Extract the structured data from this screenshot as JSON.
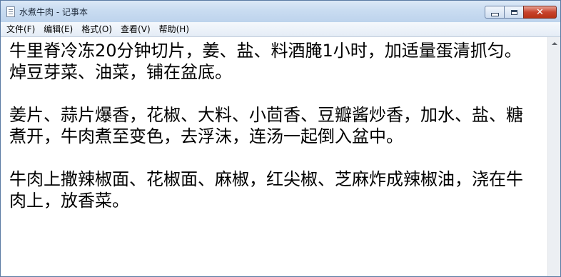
{
  "window": {
    "title": "水煮牛肉 - 记事本",
    "icon": "notepad-icon",
    "controls": {
      "minimize": "minimize-icon",
      "maximize": "maximize-icon",
      "close": "✕"
    }
  },
  "menu": {
    "file": "文件(F)",
    "edit": "编辑(E)",
    "format": "格式(O)",
    "view": "查看(V)",
    "help": "帮助(H)"
  },
  "document": {
    "text": "牛里脊冷冻20分钟切片，姜、盐、料酒腌1小时，加适量蛋清抓匀。\n焯豆芽菜、油菜，铺在盆底。\n\n姜片、蒜片爆香，花椒、大料、小茴香、豆瓣酱炒香，加水、盐、糖煮开，牛肉煮至变色，去浮沫，连汤一起倒入盆中。\n\n牛肉上撒辣椒面、花椒面、麻椒，红尖椒、芝麻炸成辣椒油，浇在牛肉上，放香菜。"
  },
  "colors": {
    "title_bar": "#c9dcf1",
    "close_button": "#c8432c",
    "editor_background": "#ffffff"
  }
}
